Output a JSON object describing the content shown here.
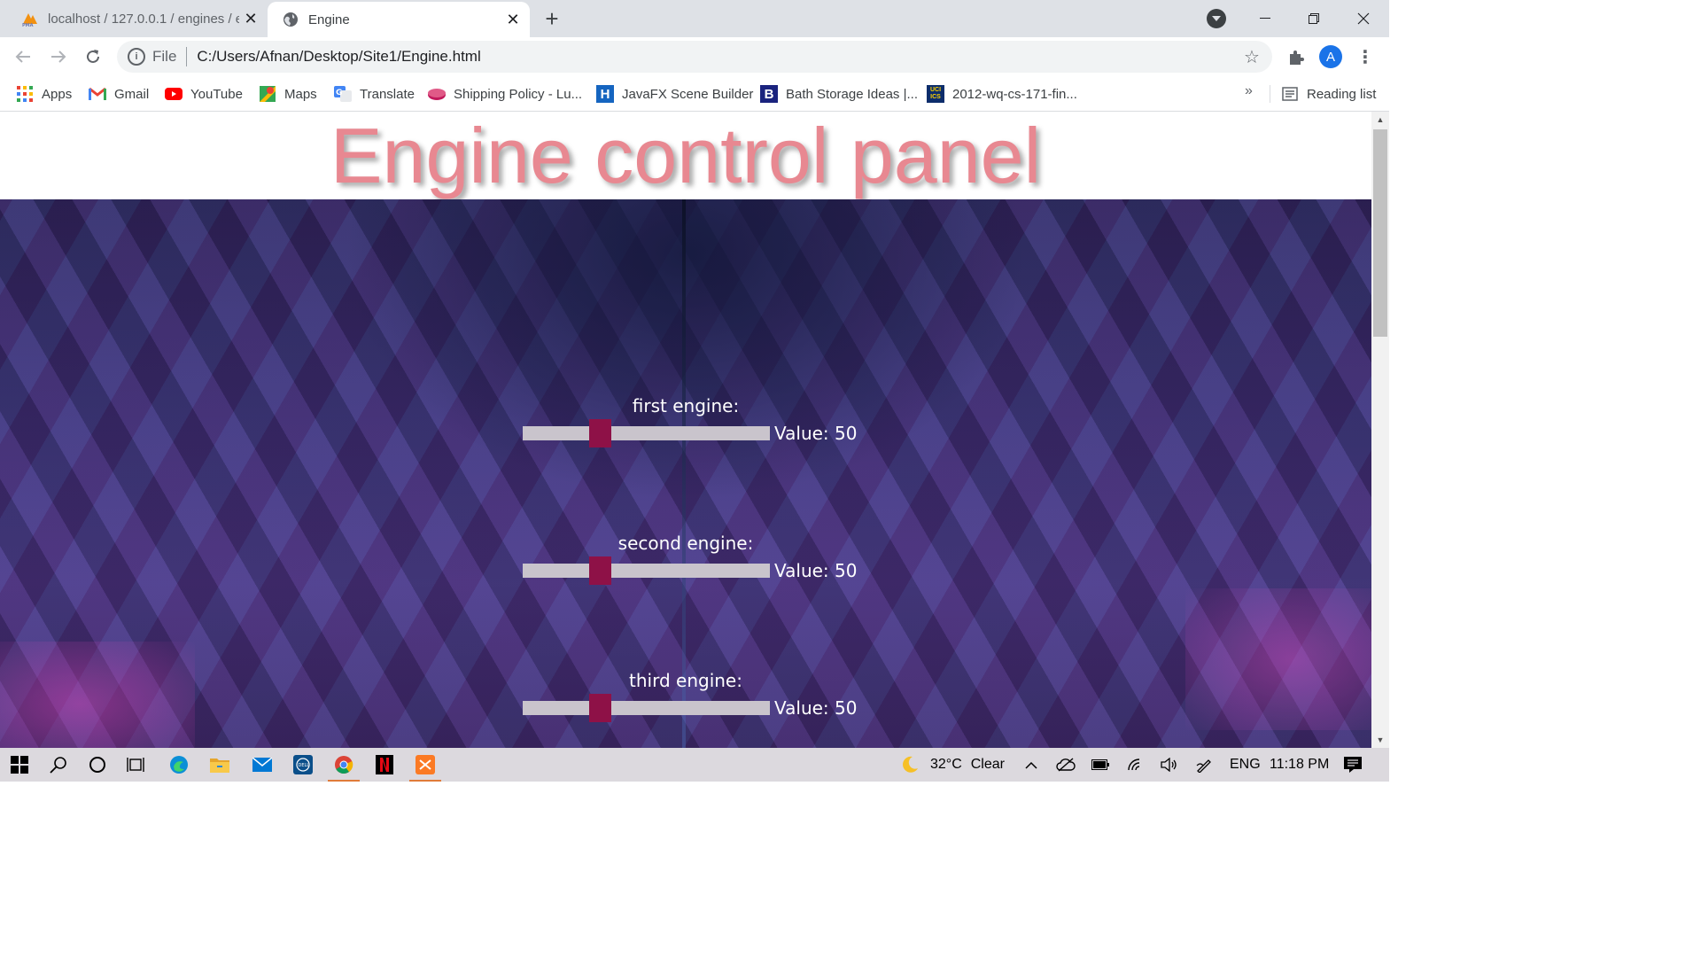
{
  "browser": {
    "tabs": [
      {
        "title": "localhost / 127.0.0.1 / engines / e",
        "favicon": "phpmyadmin-icon",
        "active": false
      },
      {
        "title": "Engine",
        "favicon": "globe-icon",
        "active": true
      }
    ],
    "address": {
      "scheme": "File",
      "url": "C:/Users/Afnan/Desktop/Site1/Engine.html"
    },
    "profile_initial": "A",
    "bookmarks": [
      {
        "label": "Apps",
        "icon": "apps-grid-icon"
      },
      {
        "label": "Gmail",
        "icon": "gmail-icon"
      },
      {
        "label": "YouTube",
        "icon": "youtube-icon"
      },
      {
        "label": "Maps",
        "icon": "maps-icon"
      },
      {
        "label": "Translate",
        "icon": "translate-icon"
      },
      {
        "label": "Shipping Policy - Lu...",
        "icon": "pink-disc-icon"
      },
      {
        "label": "JavaFX Scene Builder",
        "icon": "h-logo-icon"
      },
      {
        "label": "Bath Storage Ideas |...",
        "icon": "b-logo-icon"
      },
      {
        "label": "2012-wq-cs-171-fin...",
        "icon": "uci-ics-icon"
      }
    ],
    "bookmarks_more": "»",
    "reading_list": "Reading list"
  },
  "page": {
    "title": "Engine control panel",
    "engines": [
      {
        "label": "first engine:",
        "value_text": "Value: 50",
        "value": 50,
        "min": 0,
        "max": 170
      },
      {
        "label": "second engine:",
        "value_text": "Value: 50",
        "value": 50,
        "min": 0,
        "max": 170
      },
      {
        "label": "third engine:",
        "value_text": "Value: 50",
        "value": 50,
        "min": 0,
        "max": 170
      }
    ]
  },
  "taskbar": {
    "weather": {
      "temp": "32°C",
      "condition": "Clear"
    },
    "language": "ENG",
    "time": "11:18 PM"
  },
  "colors": {
    "title": "#e88891",
    "slider_thumb": "#8e1147",
    "slider_track": "#c9c4cc"
  }
}
